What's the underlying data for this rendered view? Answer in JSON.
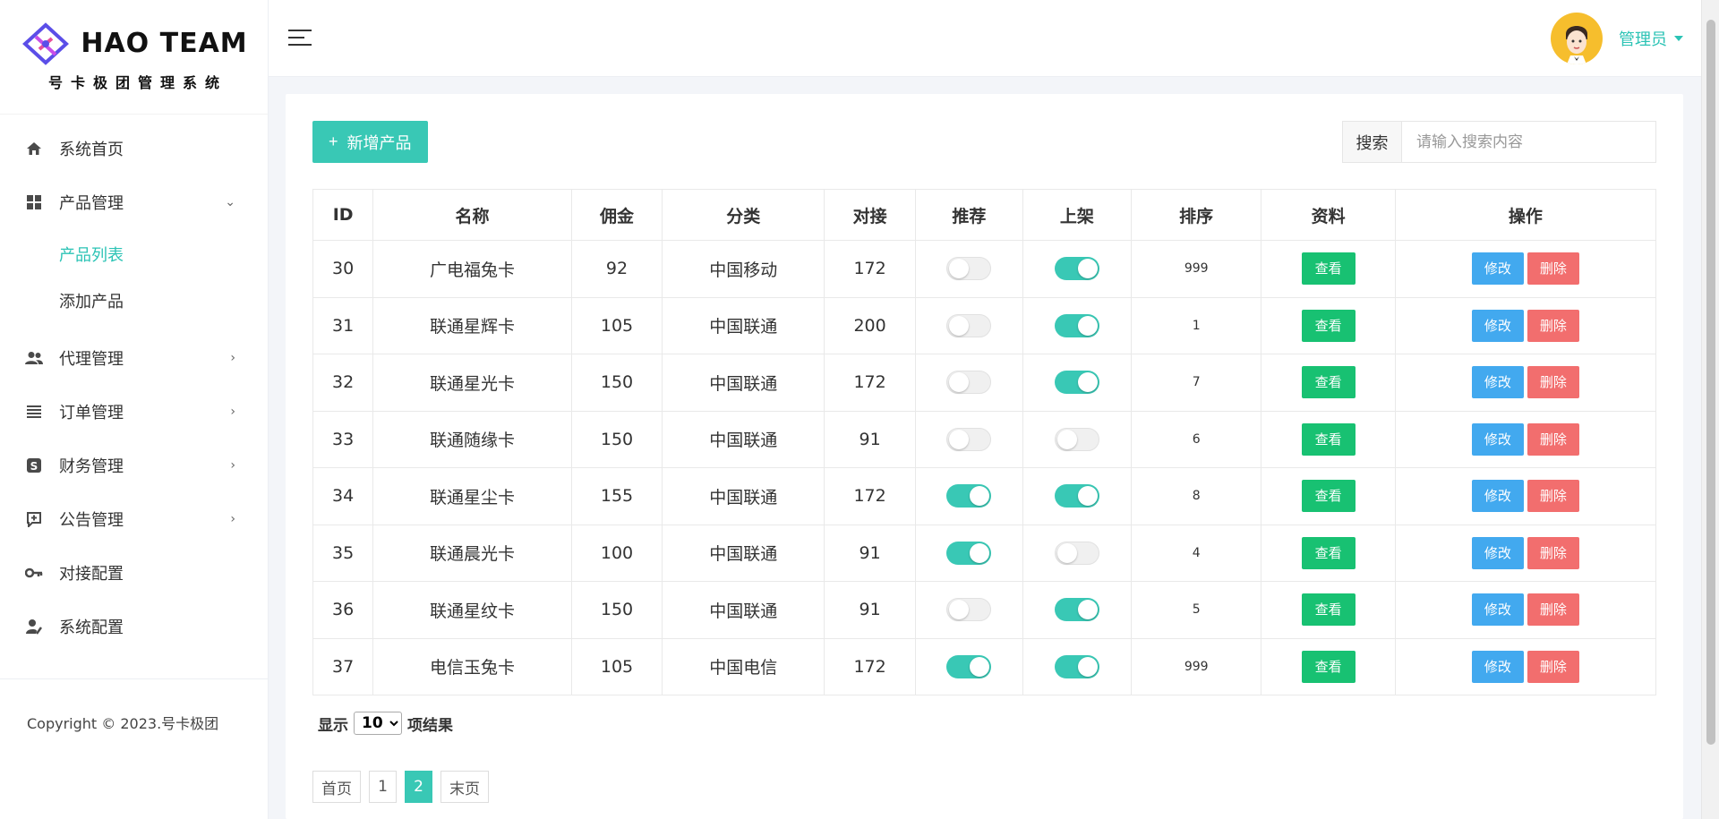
{
  "brand": {
    "title": "HAO TEAM",
    "subtitle": "号卡极团管理系统"
  },
  "sidebar": {
    "items": [
      {
        "label": "系统首页",
        "icon": "home-icon"
      },
      {
        "label": "产品管理",
        "icon": "grid-icon",
        "expanded": true,
        "children": [
          {
            "label": "产品列表",
            "active": true
          },
          {
            "label": "添加产品"
          }
        ]
      },
      {
        "label": "代理管理",
        "icon": "users-icon"
      },
      {
        "label": "订单管理",
        "icon": "list-icon"
      },
      {
        "label": "财务管理",
        "icon": "finance-icon"
      },
      {
        "label": "公告管理",
        "icon": "announcement-icon"
      },
      {
        "label": "对接配置",
        "icon": "key-icon"
      },
      {
        "label": "系统配置",
        "icon": "user-settings-icon"
      }
    ],
    "copyright": "Copyright © 2023.号卡极团"
  },
  "header": {
    "user_name": "管理员"
  },
  "toolbar": {
    "add_label": "新增产品",
    "search_label": "搜索",
    "search_placeholder": "请输入搜索内容",
    "search_value": ""
  },
  "table": {
    "columns": [
      "ID",
      "名称",
      "佣金",
      "分类",
      "对接",
      "推荐",
      "上架",
      "排序",
      "资料",
      "操作"
    ],
    "view_label": "查看",
    "edit_label": "修改",
    "delete_label": "删除",
    "rows": [
      {
        "id": "30",
        "name": "广电福兔卡",
        "commission": "92",
        "category": "中国移动",
        "dock": "172",
        "recommend": false,
        "listed": true,
        "sort": "999"
      },
      {
        "id": "31",
        "name": "联通星辉卡",
        "commission": "105",
        "category": "中国联通",
        "dock": "200",
        "recommend": false,
        "listed": true,
        "sort": "1"
      },
      {
        "id": "32",
        "name": "联通星光卡",
        "commission": "150",
        "category": "中国联通",
        "dock": "172",
        "recommend": false,
        "listed": true,
        "sort": "7"
      },
      {
        "id": "33",
        "name": "联通随缘卡",
        "commission": "150",
        "category": "中国联通",
        "dock": "91",
        "recommend": false,
        "listed": false,
        "sort": "6"
      },
      {
        "id": "34",
        "name": "联通星尘卡",
        "commission": "155",
        "category": "中国联通",
        "dock": "172",
        "recommend": true,
        "listed": true,
        "sort": "8"
      },
      {
        "id": "35",
        "name": "联通晨光卡",
        "commission": "100",
        "category": "中国联通",
        "dock": "91",
        "recommend": true,
        "listed": false,
        "sort": "4"
      },
      {
        "id": "36",
        "name": "联通星纹卡",
        "commission": "150",
        "category": "中国联通",
        "dock": "91",
        "recommend": false,
        "listed": true,
        "sort": "5"
      },
      {
        "id": "37",
        "name": "电信玉兔卡",
        "commission": "105",
        "category": "中国电信",
        "dock": "172",
        "recommend": true,
        "listed": true,
        "sort": "999"
      }
    ]
  },
  "footer": {
    "show_prefix": "显示",
    "page_size": "10",
    "page_size_options": [
      "10"
    ],
    "show_suffix": "项结果",
    "pager": {
      "first": "首页",
      "pages": [
        "1",
        "2"
      ],
      "current": "2",
      "last": "末页"
    }
  },
  "colors": {
    "accent": "#39c8b5",
    "view": "#18c172",
    "edit": "#42a9ef",
    "delete": "#f26e6e"
  }
}
